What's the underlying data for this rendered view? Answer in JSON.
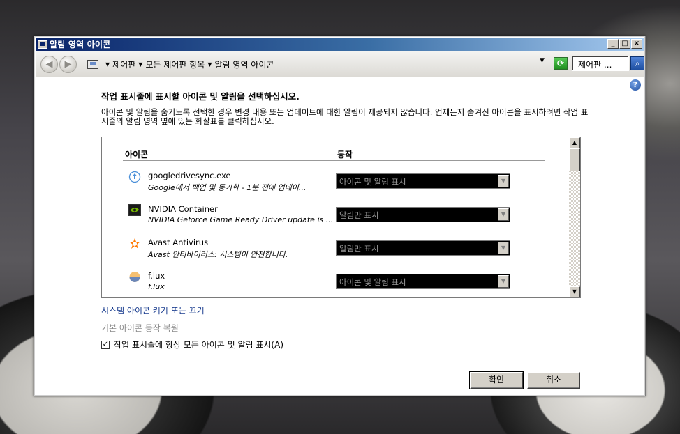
{
  "window": {
    "title": "알림 영역 아이콘"
  },
  "titlebar_buttons": {
    "minimize": "_",
    "maximize": "□",
    "close": "×"
  },
  "breadcrumb": [
    "제어판",
    "모든 제어판 항목",
    "알림 영역 아이콘"
  ],
  "search": {
    "value": "제어판 ..."
  },
  "heading": "작업 표시줄에 표시할 아이콘 및 알림을 선택하십시오.",
  "description": "아이콘 및 알림을 숨기도록 선택한 경우 변경 내용 또는 업데이트에 대한 알림이 제공되지 않습니다. 언제든지 숨겨진 아이콘을 표시하려면 작업 표시줄의 알림 영역 옆에 있는 화살표를 클릭하십시오.",
  "columns": {
    "icons": "아이콘",
    "behavior": "동작"
  },
  "items": [
    {
      "name": "googledrivesync.exe",
      "subtitle": "Google에서 백업 및 동기화 - 1분 전에 업데이...",
      "behavior": "아이콘 및 알림 표시",
      "icon": "google-drive-cloud-icon",
      "color": "#4a8fd8"
    },
    {
      "name": "NVIDIA Container",
      "subtitle": "NVIDIA Geforce Game Ready Driver update is ...",
      "behavior": "알림만 표시",
      "icon": "nvidia-icon",
      "color": "#76b900"
    },
    {
      "name": "Avast Antivirus",
      "subtitle": "Avast 안티바이러스: 시스템이 안전합니다.",
      "behavior": "알림만 표시",
      "icon": "avast-icon",
      "color": "#ff7800"
    },
    {
      "name": "f.lux",
      "subtitle": "f.lux",
      "behavior": "아이콘 및 알림 표시",
      "icon": "flux-icon",
      "color": "#f0a040"
    }
  ],
  "links": {
    "system_icons": "시스템 아이콘 켜기 또는 끄기",
    "restore_default": "기본 아이콘 동작 복원"
  },
  "always_show": {
    "label": "작업 표시줄에 항상 모든 아이콘 및 알림 표시(A)",
    "checked": true
  },
  "buttons": {
    "ok": "확인",
    "cancel": "취소"
  }
}
